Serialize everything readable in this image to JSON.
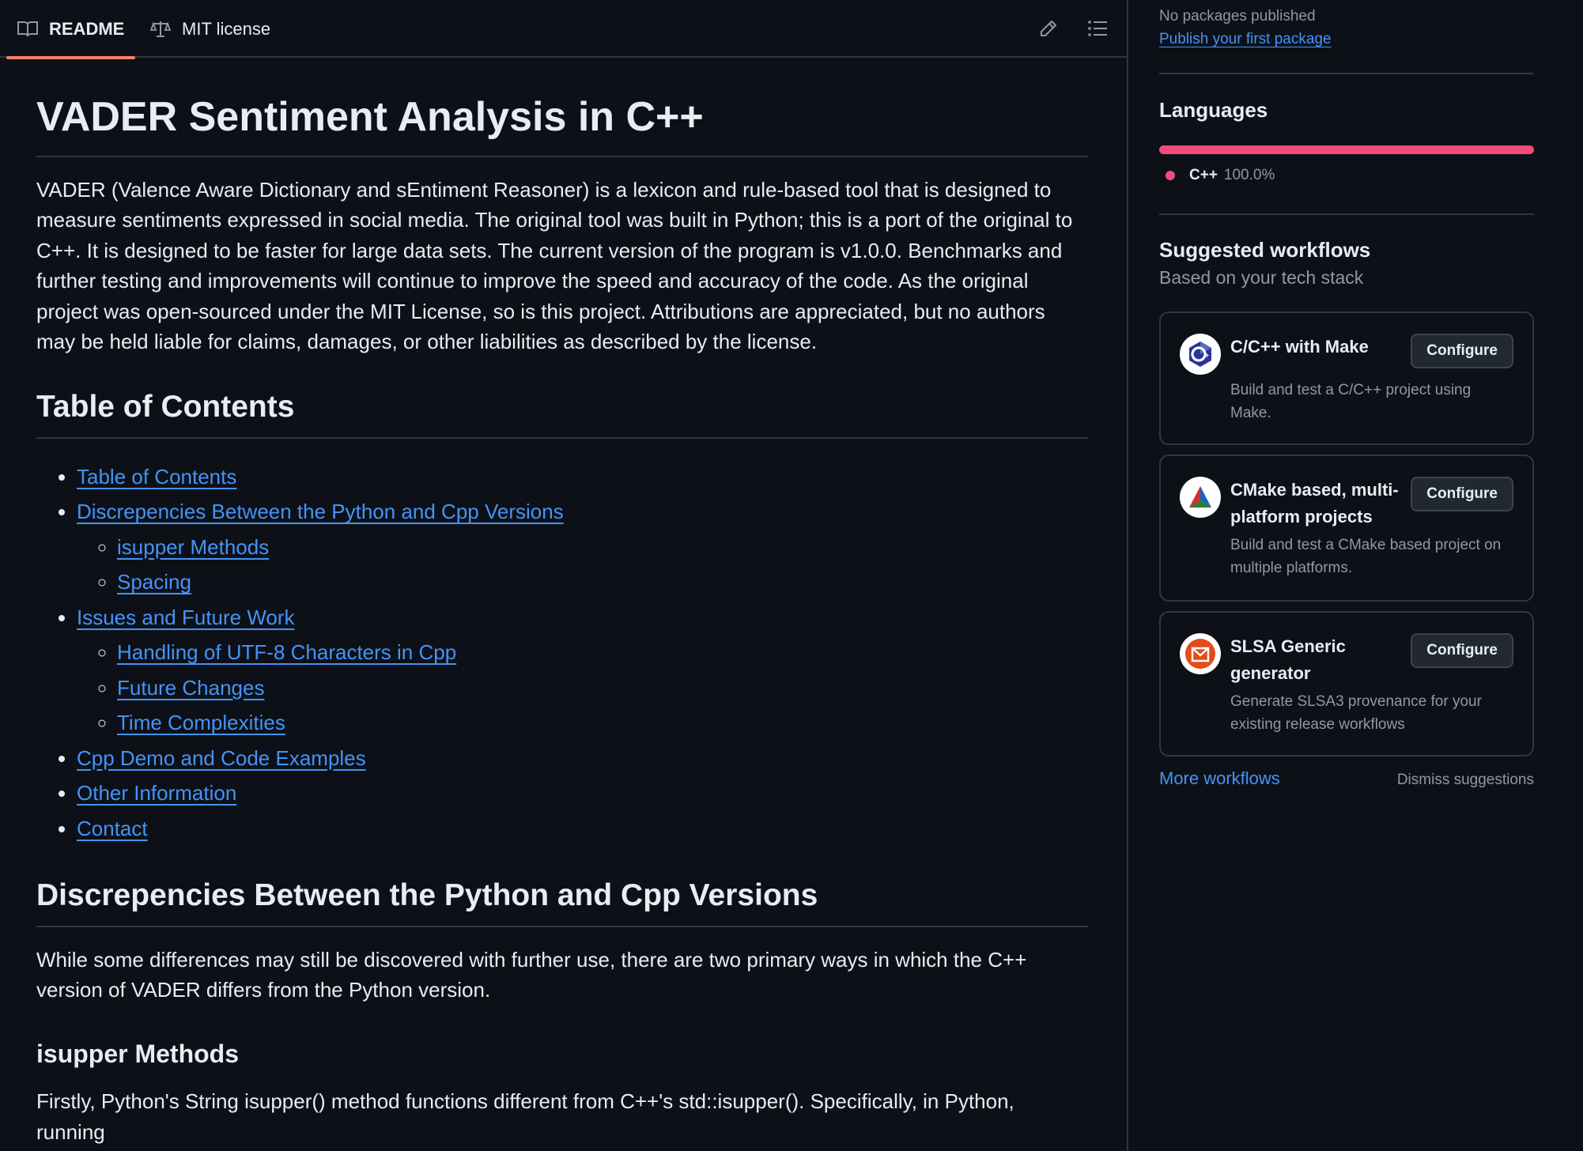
{
  "tabs": {
    "readme": "README",
    "license": "MIT license"
  },
  "readme": {
    "title": "VADER Sentiment Analysis in C++",
    "intro": "VADER (Valence Aware Dictionary and sEntiment Reasoner) is a lexicon and rule-based tool that is designed to measure sentiments expressed in social media. The original tool was built in Python; this is a port of the original to C++. It is designed to be faster for large data sets. The current version of the program is v1.0.0. Benchmarks and further testing and improvements will continue to improve the speed and accuracy of the code. As the original project was open-sourced under the MIT License, so is this project. Attributions are appreciated, but no authors may be held liable for claims, damages, or other liabilities as described by the license.",
    "toc_heading": "Table of Contents",
    "toc": [
      {
        "label": "Table of Contents",
        "children": []
      },
      {
        "label": "Discrepencies Between the Python and Cpp Versions",
        "children": [
          "isupper Methods",
          "Spacing"
        ]
      },
      {
        "label": "Issues and Future Work",
        "children": [
          "Handling of UTF-8 Characters in Cpp",
          "Future Changes",
          "Time Complexities"
        ]
      },
      {
        "label": "Cpp Demo and Code Examples",
        "children": []
      },
      {
        "label": "Other Information",
        "children": []
      },
      {
        "label": "Contact",
        "children": []
      }
    ],
    "discrepencies_heading": "Discrepencies Between the Python and Cpp Versions",
    "discrepencies_text": "While some differences may still be discovered with further use, there are two primary ways in which the C++ version of VADER differs from the Python version.",
    "isupper_heading": "isupper Methods",
    "isupper_text": "Firstly, Python's String isupper() method functions different from C++'s std::isupper(). Specifically, in Python, running"
  },
  "sidebar": {
    "packages": {
      "status": "No packages published",
      "link": "Publish your first package"
    },
    "languages": {
      "heading": "Languages",
      "items": [
        {
          "name": "C++",
          "percent": "100.0%",
          "fraction": 1.0,
          "color": "#f34b7d"
        }
      ]
    },
    "workflows": {
      "heading": "Suggested workflows",
      "subheading": "Based on your tech stack",
      "cards": [
        {
          "title": "C/C++ with Make",
          "description": "Build and test a C/C++ project using Make.",
          "button": "Configure",
          "icon": "cpp-icon"
        },
        {
          "title": "CMake based, multi-platform projects",
          "description": "Build and test a CMake based project on multiple platforms.",
          "button": "Configure",
          "icon": "cmake-icon"
        },
        {
          "title": "SLSA Generic generator",
          "description": "Generate SLSA3 provenance for your existing release workflows",
          "button": "Configure",
          "icon": "slsa-icon"
        }
      ],
      "more": "More workflows",
      "dismiss": "Dismiss suggestions"
    }
  }
}
